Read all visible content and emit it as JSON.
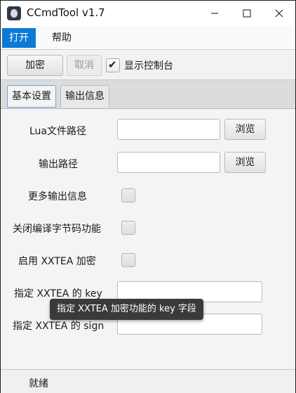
{
  "window": {
    "title": "CCmdTool v1.7"
  },
  "menu": {
    "items": [
      "打开",
      "帮助"
    ]
  },
  "toolbar": {
    "encrypt_label": "加密",
    "cancel_label": "取消",
    "show_console_label": "显示控制台",
    "show_console_checked": true
  },
  "tabs": {
    "items": [
      "基本设置",
      "输出信息"
    ],
    "active": "基本设置"
  },
  "form": {
    "lua_path_label": "Lua文件路径",
    "lua_path_value": "",
    "browse_label": "浏览",
    "output_path_label": "输出路径",
    "output_path_value": "",
    "more_output_label": "更多输出信息",
    "disable_bytecode_label": "关闭编译字节码功能",
    "enable_xxtea_label": "启用 XXTEA 加密",
    "xxtea_key_label": "指定 XXTEA 的 key",
    "xxtea_key_value": "",
    "xxtea_sign_label": "指定 XXTEA 的 sign",
    "xxtea_sign_value": ""
  },
  "tooltip": {
    "text": "指定 XXTEA 加密功能的 key 字段"
  },
  "status": {
    "text": "就绪"
  },
  "colors": {
    "accent": "#0a7ad6",
    "tooltip_bg": "#3a3a3a"
  }
}
